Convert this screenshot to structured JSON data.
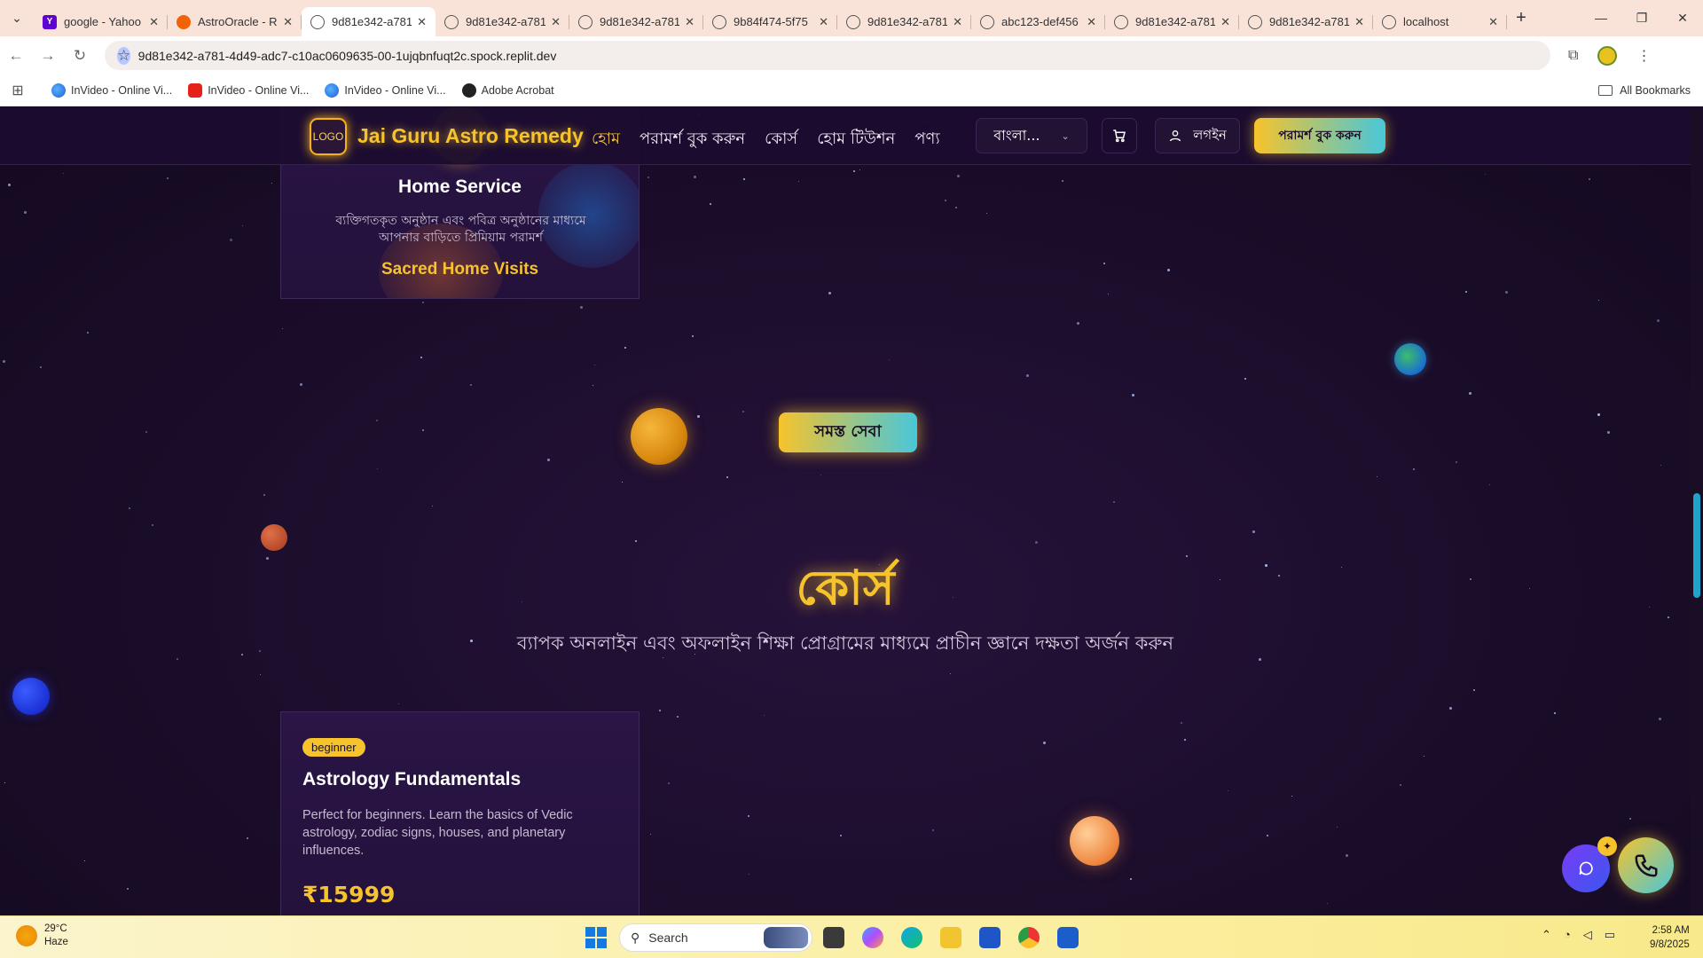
{
  "browser": {
    "tabs": [
      {
        "title": "google - Yahoo",
        "favicon": "yahoo-icon",
        "active": false
      },
      {
        "title": "AstroOracle - R",
        "favicon": "replit-icon",
        "active": false
      },
      {
        "title": "9d81e342-a781",
        "favicon": "globe-icon",
        "active": true
      },
      {
        "title": "9d81e342-a781",
        "favicon": "globe-icon",
        "active": false
      },
      {
        "title": "9d81e342-a781",
        "favicon": "globe-icon",
        "active": false
      },
      {
        "title": "9b84f474-5f75",
        "favicon": "globe-icon",
        "active": false
      },
      {
        "title": "9d81e342-a781",
        "favicon": "globe-icon",
        "active": false
      },
      {
        "title": "abc123-def456",
        "favicon": "globe-icon",
        "active": false
      },
      {
        "title": "9d81e342-a781",
        "favicon": "globe-icon",
        "active": false
      },
      {
        "title": "9d81e342-a781",
        "favicon": "globe-icon",
        "active": false
      },
      {
        "title": "localhost",
        "favicon": "globe-icon",
        "active": false
      }
    ],
    "url": "9d81e342-a781-4d49-adc7-c10ac0609635-00-1ujqbnfuqt2c.spock.replit.dev",
    "bookmarks": [
      {
        "label": "InVideo - Online Vi...",
        "icon": "invideo-icon"
      },
      {
        "label": "InVideo - Online Vi...",
        "icon": "youtube-icon"
      },
      {
        "label": "InVideo - Online Vi...",
        "icon": "invideo-icon"
      },
      {
        "label": "Adobe Acrobat",
        "icon": "acrobat-icon"
      }
    ],
    "all_bookmarks_label": "All Bookmarks"
  },
  "site": {
    "logo_text": "LOGO",
    "brand": "Jai Guru Astro Remedy",
    "nav": [
      "হোম",
      "পরামর্শ বুক করুন",
      "কোর্স",
      "হোম টিউশন",
      "পণ্য"
    ],
    "language": "বাংলা...",
    "login_label": "লগইন",
    "cta_label": "পরামর্শ বুক করুন",
    "accent_color": "#f7c32c",
    "secondary_color": "#48c7d9"
  },
  "service_card": {
    "icon": "home-icon",
    "title": "Home Service",
    "description": "ব্যক্তিগতকৃত অনুষ্ঠান এবং পবিত্র অনুষ্ঠানের মাধ্যমে আপনার বাড়িতে প্রিমিয়াম পরামর্শ",
    "tagline": "Sacred Home Visits"
  },
  "all_services_label": "সমস্ত সেবা",
  "courses_section": {
    "title": "কোর্স",
    "subtitle": "ব্যাপক অনলাইন এবং অফলাইন শিক্ষা প্রোগ্রামের মাধ্যমে প্রাচীন জ্ঞানে দক্ষতা অর্জন করুন"
  },
  "course_card": {
    "badge": "beginner",
    "title": "Astrology Fundamentals",
    "description": "Perfect for beginners. Learn the basics of Vedic astrology, zodiac signs, houses, and planetary influences.",
    "price": "₹15999"
  },
  "taskbar": {
    "temperature": "29°C",
    "weather": "Haze",
    "search_placeholder": "Search",
    "time": "2:58 AM",
    "date": "9/8/2025"
  }
}
